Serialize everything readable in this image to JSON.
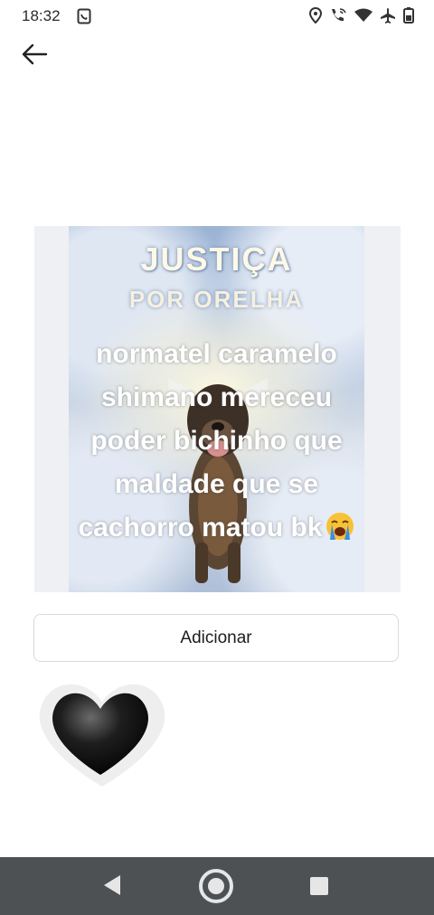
{
  "status_bar": {
    "time": "18:32",
    "icons": [
      "clipboard-phone-icon",
      "location-icon",
      "wifi-calling-icon",
      "wifi-icon",
      "airplane-icon",
      "battery-icon"
    ]
  },
  "app_bar": {
    "back_icon": "arrow-left-icon"
  },
  "sticker": {
    "title": "JUSTIÇA",
    "subtitle": "POR ORELHA",
    "caption_lines": [
      "normatel caramelo",
      "shimano mereceu",
      "poder bichinho que",
      "maldade que se",
      "cachorro matou bk"
    ],
    "caption_emoji": "loudly-crying-face-icon"
  },
  "add_button": {
    "label": "Adicionar"
  },
  "reaction": {
    "icon": "black-heart-icon"
  },
  "nav_bar": {
    "icons": [
      "nav-back-icon",
      "nav-home-icon",
      "nav-recents-icon"
    ]
  },
  "colors": {
    "nav_bar": "#4d5154",
    "card_bg": "#eef0f3",
    "button_border": "#d9d9d9"
  }
}
